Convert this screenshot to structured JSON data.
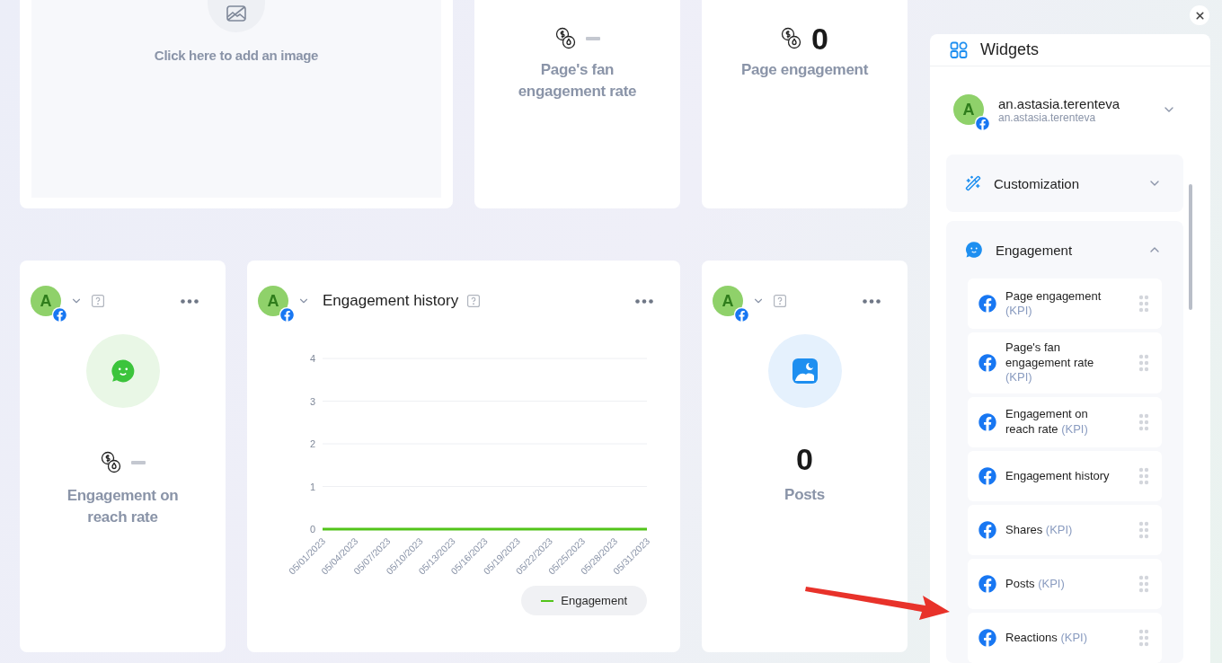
{
  "image_card": {
    "placeholder": "Click here to add an image"
  },
  "top_kpis": [
    {
      "label": "Page's fan engagement rate"
    },
    {
      "value": "0",
      "label": "Page engagement"
    }
  ],
  "widgets": [
    {
      "kind": "smile",
      "avatar": "A",
      "label": "Engagement on reach rate"
    },
    {
      "kind": "chart",
      "avatar": "A",
      "title": "Engagement history",
      "chart_data": {
        "type": "line",
        "categories": [
          "05/01/2023",
          "05/04/2023",
          "05/07/2023",
          "05/10/2023",
          "05/13/2023",
          "05/16/2023",
          "05/19/2023",
          "05/22/2023",
          "05/25/2023",
          "05/28/2023",
          "05/31/2023"
        ],
        "series": [
          {
            "name": "Engagement",
            "color": "#52c41a",
            "values": [
              0,
              0,
              0,
              0,
              0,
              0,
              0,
              0,
              0,
              0,
              0
            ]
          }
        ],
        "ylim": [
          0,
          4
        ],
        "yticks": [
          0,
          1,
          2,
          3,
          4
        ],
        "grid": true
      }
    },
    {
      "kind": "photo",
      "avatar": "A",
      "value": "0",
      "label": "Posts"
    }
  ],
  "sidebar": {
    "title": "Widgets",
    "account": {
      "avatar": "A",
      "name": "an.astasia.terenteva",
      "handle": "an.astasia.terenteva",
      "expanded": false
    },
    "sections": [
      {
        "kind": "wand",
        "title": "Customization",
        "expanded": false
      },
      {
        "kind": "smile",
        "title": "Engagement",
        "expanded": true,
        "items": [
          {
            "name": "Page engagement",
            "tag": "(KPI)"
          },
          {
            "name": "Page's fan engagement rate",
            "tag": "(KPI)"
          },
          {
            "name": "Engagement on reach rate",
            "tag": "(KPI)"
          },
          {
            "name": "Engagement history"
          },
          {
            "name": "Shares",
            "tag": "(KPI)"
          },
          {
            "name": "Posts",
            "tag": "(KPI)"
          },
          {
            "name": "Reactions",
            "tag": "(KPI)"
          }
        ]
      }
    ]
  }
}
